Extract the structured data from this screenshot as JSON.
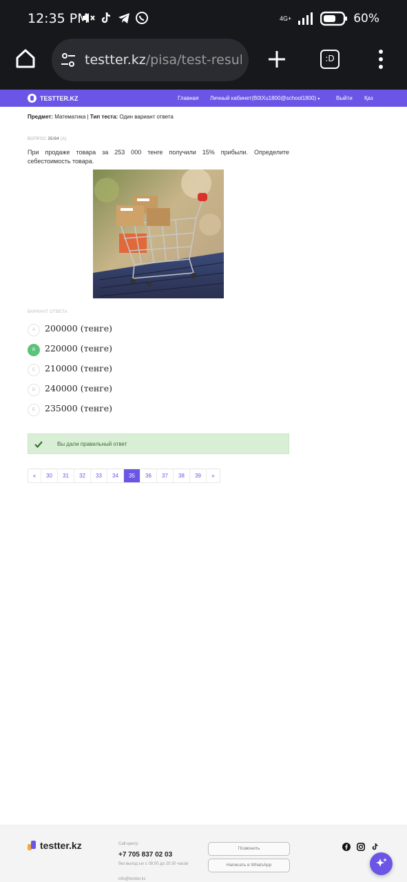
{
  "status_bar": {
    "time": "12:35 PM",
    "network": "4G+",
    "battery": "60%",
    "icons": [
      "volume-x-icon",
      "tiktok-icon",
      "telegram-icon",
      "whatsapp-icon"
    ]
  },
  "browser": {
    "url_host": "testter.kz",
    "url_path": "/pisa/test-result/s",
    "tabs_label": ":D"
  },
  "site_header": {
    "logo": "TESTTER.KZ",
    "nav": {
      "home": "Главная",
      "cabinet": "Личный кабинет(B0tXu1800@school1800)",
      "logout": "Выйти",
      "lang": "Қаз"
    }
  },
  "meta": {
    "subject_label": "Предмет:",
    "subject_value": "Математика",
    "separator": "|",
    "type_label": "Тип теста:",
    "type_value": "Один вариант ответа"
  },
  "question": {
    "label": "ВОПРОС",
    "number": "35/84",
    "suffix": "(A)",
    "text": "При продаже товара за 253 000 тенге получили 15% прибыли. Определите себестоимость товара."
  },
  "answers_label": "ВАРИАНТ ОТВЕТА",
  "answers": [
    {
      "letter": "A",
      "text": "200000 (тенге)",
      "correct": false
    },
    {
      "letter": "B",
      "text": "220000 (тенге)",
      "correct": true
    },
    {
      "letter": "C",
      "text": "210000 (тенге)",
      "correct": false
    },
    {
      "letter": "D",
      "text": "240000 (тенге)",
      "correct": false
    },
    {
      "letter": "E",
      "text": "235000 (тенге)",
      "correct": false
    }
  ],
  "result": {
    "text": "Вы дали правильный ответ"
  },
  "pagination": {
    "prev": "«",
    "pages": [
      "30",
      "31",
      "32",
      "33",
      "34",
      "35",
      "36",
      "37",
      "38",
      "39"
    ],
    "active": "35",
    "next": "»"
  },
  "footer": {
    "logo": "testter.kz",
    "call_label": "Call-центр",
    "phone": "+7 705 837 02 03",
    "hours": "без выход ых с 08:00 до 20:30 часов",
    "email": "info@testter.kz",
    "call_button": "Позвонить",
    "whatsapp_button": "Написать в WhatsApp"
  },
  "colors": {
    "brand": "#6b55e6",
    "correct": "#5cc378",
    "result_bg": "#d8eed5"
  }
}
